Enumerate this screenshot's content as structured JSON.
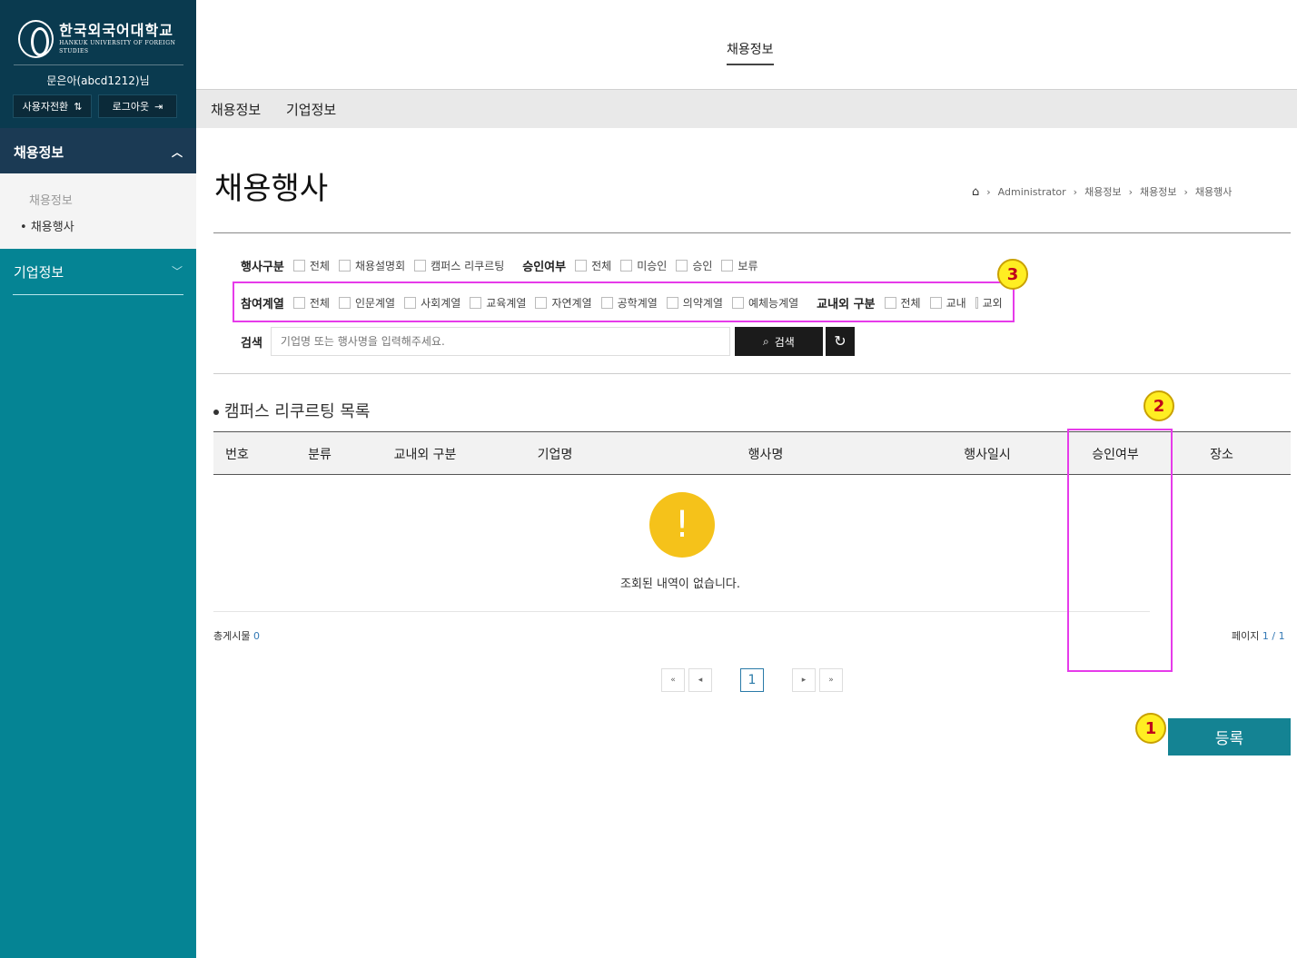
{
  "sidebar": {
    "logo_kr": "한국외국어대학교",
    "logo_en": "HANKUK UNIVERSITY OF FOREIGN STUDIES",
    "user": "문은아(abcd1212)님",
    "switch_user_label": "사용자전환",
    "logout_label": "로그아웃",
    "menu": [
      {
        "label": "채용정보",
        "expanded": true,
        "children": [
          "채용정보",
          "채용행사"
        ]
      },
      {
        "label": "기업정보",
        "expanded": false
      }
    ]
  },
  "header": {
    "title": "채용정보",
    "nav": [
      "채용정보",
      "기업정보"
    ]
  },
  "page": {
    "title": "채용행사",
    "breadcrumb": [
      "Administrator",
      "채용정보",
      "채용정보",
      "채용행사"
    ]
  },
  "filters": {
    "event_type": {
      "label": "행사구분",
      "options": [
        "전체",
        "채용설명회",
        "캠퍼스 리쿠르팅"
      ]
    },
    "approval": {
      "label": "승인여부",
      "options": [
        "전체",
        "미승인",
        "승인",
        "보류"
      ]
    },
    "field": {
      "label": "참여계열",
      "options": [
        "전체",
        "인문계열",
        "사회계열",
        "교육계열",
        "자연계열",
        "공학계열",
        "의약계열",
        "예체능계열"
      ]
    },
    "campus": {
      "label": "교내외 구분",
      "options": [
        "전체",
        "교내",
        "교외"
      ]
    },
    "search": {
      "label": "검색",
      "placeholder": "기업명 또는 행사명을 입력해주세요.",
      "button": "검색"
    }
  },
  "list": {
    "title": "캠퍼스 리쿠르팅 목록",
    "columns": [
      "번호",
      "분류",
      "교내외 구분",
      "기업명",
      "행사명",
      "행사일시",
      "승인여부",
      "장소"
    ],
    "empty_message": "조회된 내역이 없습니다.",
    "total_label": "총게시물",
    "total": "0",
    "page_label": "페이지",
    "page_value": "1 / 1",
    "current_page": "1"
  },
  "register_label": "등록",
  "annotations": [
    "1",
    "2",
    "3"
  ],
  "colors": {
    "sidebar": "#058494",
    "sidebar_dark": "#0a3a4f",
    "accent": "#148393",
    "annotation": "#e63bea",
    "badge": "#ffee22"
  }
}
